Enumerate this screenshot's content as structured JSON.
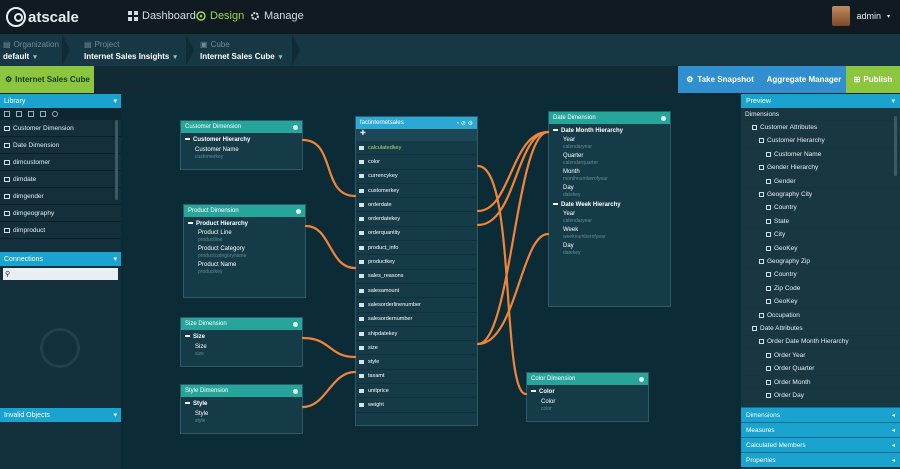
{
  "brand": {
    "name": "atscale"
  },
  "nav": [
    {
      "label": "Dashboard",
      "icon": "dashboard-icon"
    },
    {
      "label": "Design",
      "icon": "design-icon"
    },
    {
      "label": "Manage",
      "icon": "gear-icon"
    }
  ],
  "user": {
    "name": "admin"
  },
  "breadcrumb": [
    {
      "label": "Organization",
      "value": "default"
    },
    {
      "label": "Project",
      "value": "Internet Sales Insights"
    },
    {
      "label": "Cube",
      "value": "Internet Sales Cube"
    }
  ],
  "subbar": {
    "cube_tab": "Internet Sales Cube",
    "snapshot": "Take Snapshot",
    "aggregate": "Aggregate Manager",
    "publish": "Publish"
  },
  "library": {
    "title": "Library",
    "items": [
      "Customer Dimension",
      "Date Dimension",
      "dimcustomer",
      "dimdate",
      "dimgender",
      "dimgeography",
      "dimproduct"
    ]
  },
  "connections": {
    "title": "Connections",
    "search_placeholder": ""
  },
  "invalid": {
    "title": "Invalid Objects"
  },
  "preview": {
    "title": "Preview",
    "tree": [
      {
        "label": "Dimensions",
        "indent": 0,
        "icon": ""
      },
      {
        "label": "Customer Attributes",
        "indent": 1,
        "icon": "folder"
      },
      {
        "label": "Customer Hierarchy",
        "indent": 2,
        "icon": "hier"
      },
      {
        "label": "Customer Name",
        "indent": 3,
        "icon": "level"
      },
      {
        "label": "Gender Hierarchy",
        "indent": 2,
        "icon": "hier"
      },
      {
        "label": "Gender",
        "indent": 3,
        "icon": "level"
      },
      {
        "label": "Geography City",
        "indent": 2,
        "icon": "hier"
      },
      {
        "label": "Country",
        "indent": 3,
        "icon": "level"
      },
      {
        "label": "State",
        "indent": 3,
        "icon": "level"
      },
      {
        "label": "City",
        "indent": 3,
        "icon": "level"
      },
      {
        "label": "GeoKey",
        "indent": 3,
        "icon": "level"
      },
      {
        "label": "Geography Zip",
        "indent": 2,
        "icon": "hier"
      },
      {
        "label": "Country",
        "indent": 3,
        "icon": "level"
      },
      {
        "label": "Zip Code",
        "indent": 3,
        "icon": "level"
      },
      {
        "label": "GeoKey",
        "indent": 3,
        "icon": "level"
      },
      {
        "label": "Occupation",
        "indent": 2,
        "icon": "attr"
      },
      {
        "label": "Date Attributes",
        "indent": 1,
        "icon": "folder"
      },
      {
        "label": "Order Date Month Hierarchy",
        "indent": 2,
        "icon": "hier"
      },
      {
        "label": "Order Year",
        "indent": 3,
        "icon": "level"
      },
      {
        "label": "Order Quarter",
        "indent": 3,
        "icon": "level"
      },
      {
        "label": "Order Month",
        "indent": 3,
        "icon": "level"
      },
      {
        "label": "Order Day",
        "indent": 3,
        "icon": "level"
      }
    ],
    "footer": [
      "Dimensions",
      "Measures",
      "Calculated Members",
      "Properties"
    ]
  },
  "canvas": {
    "customer": {
      "title": "Customer Dimension",
      "hierarchy": "Customer Hierarchy",
      "levels": [
        {
          "name": "Customer Name",
          "sub": "customerkey"
        }
      ]
    },
    "product": {
      "title": "Product Dimension",
      "hierarchy": "Product Hierarchy",
      "levels": [
        {
          "name": "Product Line",
          "sub": "productline"
        },
        {
          "name": "Product Category",
          "sub": "productcategoryname"
        },
        {
          "name": "Product Name",
          "sub": "productkey"
        }
      ]
    },
    "size": {
      "title": "Size Dimension",
      "hierarchy": "Size",
      "levels": [
        {
          "name": "Size",
          "sub": "size"
        }
      ]
    },
    "style": {
      "title": "Style Dimension",
      "hierarchy": "Style",
      "levels": [
        {
          "name": "Style",
          "sub": "style"
        }
      ]
    },
    "fact": {
      "title": "factinternetsales",
      "columns": [
        "calculatedkey",
        "color",
        "currencykey",
        "customerkey",
        "orderdate",
        "orderdatekey",
        "orderquantity",
        "product_info",
        "productkey",
        "sales_reasons",
        "salesamount",
        "salesorderlinenumber",
        "salesordernumber",
        "shipdatekey",
        "size",
        "style",
        "taxamt",
        "unitprice",
        "weight"
      ]
    },
    "date": {
      "title": "Date Dimension",
      "hierarchy1": "Date Month Hierarchy",
      "levels1": [
        {
          "name": "Year",
          "sub": "calendaryear"
        },
        {
          "name": "Quarter",
          "sub": "calendarquarter"
        },
        {
          "name": "Month",
          "sub": "monthnumberofyear"
        },
        {
          "name": "Day",
          "sub": "datekey"
        }
      ],
      "hierarchy2": "Date Week Hierarchy",
      "levels2": [
        {
          "name": "Year",
          "sub": "calendaryear"
        },
        {
          "name": "Week",
          "sub": "weeknumberofyear"
        },
        {
          "name": "Day",
          "sub": "datekey"
        }
      ]
    },
    "color": {
      "title": "Color Dimension",
      "hierarchy": "Color",
      "levels": [
        {
          "name": "Color",
          "sub": "color"
        }
      ]
    }
  },
  "colors": {
    "accent_green": "#8cc63f",
    "accent_blue": "#1aa3cf",
    "link_orange": "#f0853a",
    "dim_header": "#26a69a"
  }
}
